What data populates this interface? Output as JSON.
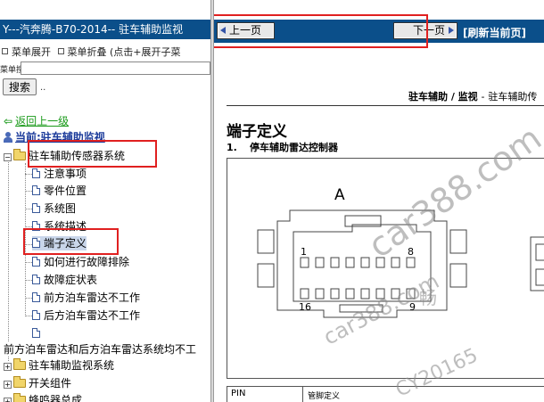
{
  "left": {
    "title": "Y---汽奔腾-B70-2014-- 驻车辅助监视",
    "menu_expand": "菜单展开",
    "menu_collapse": "菜单折叠 (点击+展开子菜",
    "search_label": "菜单搜索",
    "search_button": "搜索",
    "search_suffix": "..",
    "back_link": "返回上一级",
    "current_link": "当前:驻车辅助监视",
    "tree": {
      "folder_sensor": "驻车辅助传感器系统",
      "items": [
        "注意事项",
        "零件位置",
        "系统图",
        "系统描述",
        "端子定义",
        "如何进行故障排除",
        "故障症状表",
        "前方泊车雷达不工作",
        "后方泊车雷达不工作"
      ],
      "long_item": "前方泊车雷达和后方泊车雷达系统均不工",
      "folder_monitor": "驻车辅助监视系统",
      "folder_switch": "开关组件",
      "folder_buzzer": "蜂鸣器总成"
    }
  },
  "right": {
    "prev_label": "上一页",
    "next_label": "下一页",
    "refresh_label": "[刷新当前页]",
    "doc_header_bold": "驻车辅助 / 监视",
    "doc_header_sep": "-",
    "doc_header_rest": "驻车辅助传",
    "section_title": "端子定义",
    "subsection_num": "1.",
    "subsection_title": "停车辅助雷达控制器",
    "connector_label": "A",
    "pins": [
      "1",
      "8",
      "16",
      "9"
    ],
    "table_col1": "PIN",
    "table_col2": "管脚定义"
  },
  "watermark": {
    "line1": "car388.com",
    "line2": "car388.com",
    "line3": "CY20165",
    "cn": "畅"
  },
  "colors": {
    "title_bar": "#0b4f8a",
    "highlight_box": "#e02020",
    "link_green": "#1a9a1a",
    "link_blue": "#1a3a9a"
  }
}
